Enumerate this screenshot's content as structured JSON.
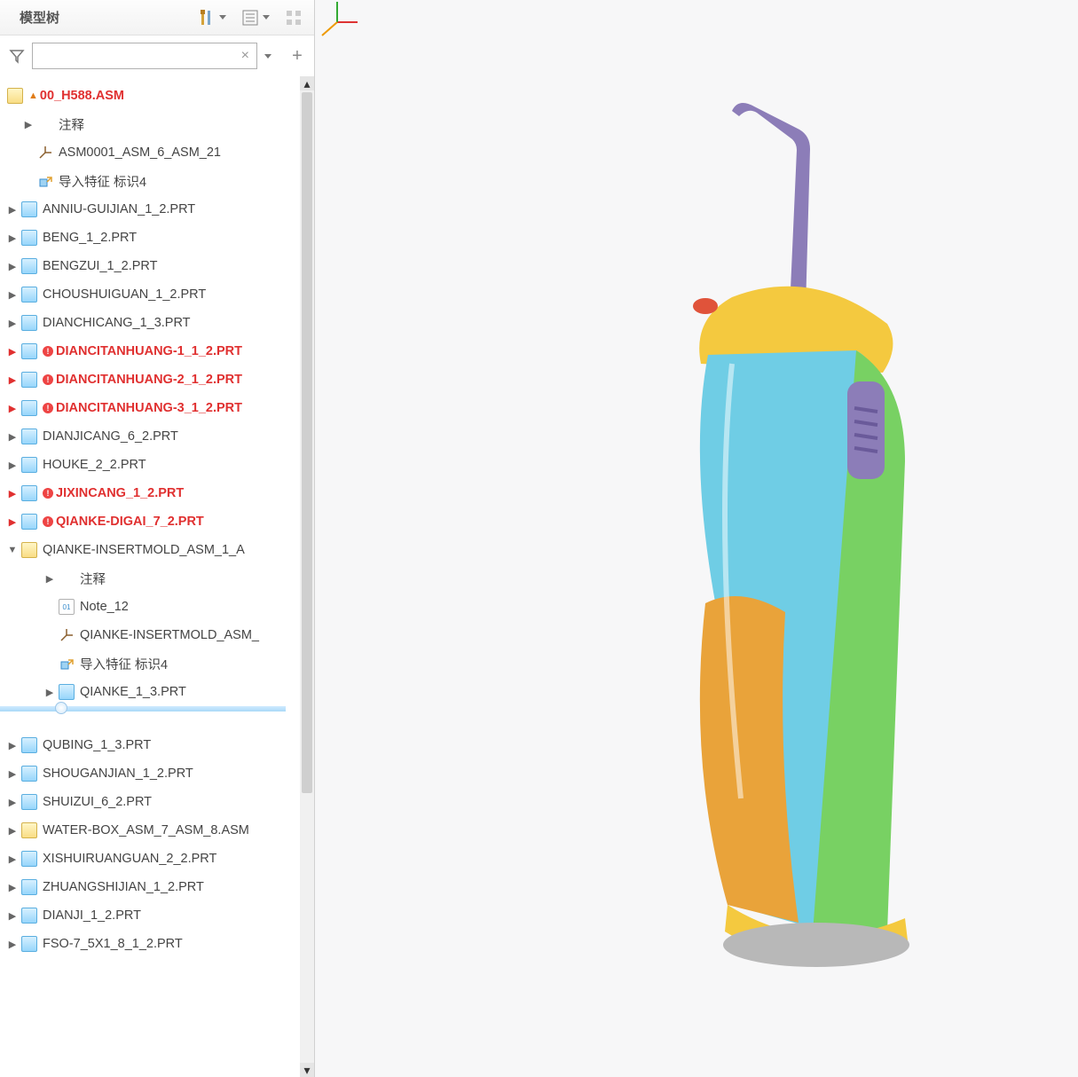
{
  "panel_title": "模型树",
  "root": {
    "name": "00_H588.ASM",
    "warning": true
  },
  "items": [
    {
      "exp": "closed",
      "indent": 1,
      "icon": "",
      "label": "注释"
    },
    {
      "exp": "none",
      "indent": 1,
      "icon": "csys",
      "label": "ASM0001_ASM_6_ASM_21"
    },
    {
      "exp": "none",
      "indent": 1,
      "icon": "import",
      "label": "导入特征 标识4"
    },
    {
      "exp": "closed",
      "indent": 0,
      "icon": "prt",
      "label": "ANNIU-GUIJIAN_1_2.PRT"
    },
    {
      "exp": "closed",
      "indent": 0,
      "icon": "prt",
      "label": "BENG_1_2.PRT"
    },
    {
      "exp": "closed",
      "indent": 0,
      "icon": "prt",
      "label": "BENGZUI_1_2.PRT"
    },
    {
      "exp": "closed",
      "indent": 0,
      "icon": "prt",
      "label": "CHOUSHUIGUAN_1_2.PRT"
    },
    {
      "exp": "closed",
      "indent": 0,
      "icon": "prt",
      "label": "DIANCHICANG_1_3.PRT"
    },
    {
      "exp": "closed",
      "indent": 0,
      "icon": "prt",
      "label": "DIANCITANHUANG-1_1_2.PRT",
      "error": true,
      "redExp": true
    },
    {
      "exp": "closed",
      "indent": 0,
      "icon": "prt",
      "label": "DIANCITANHUANG-2_1_2.PRT",
      "error": true,
      "redExp": true
    },
    {
      "exp": "closed",
      "indent": 0,
      "icon": "prt",
      "label": "DIANCITANHUANG-3_1_2.PRT",
      "error": true,
      "redExp": true
    },
    {
      "exp": "closed",
      "indent": 0,
      "icon": "prt",
      "label": "DIANJICANG_6_2.PRT"
    },
    {
      "exp": "closed",
      "indent": 0,
      "icon": "prt",
      "label": "HOUKE_2_2.PRT"
    },
    {
      "exp": "closed",
      "indent": 0,
      "icon": "prt",
      "label": "JIXINCANG_1_2.PRT",
      "error": true,
      "redExp": true
    },
    {
      "exp": "closed",
      "indent": 0,
      "icon": "prt",
      "label": "QIANKE-DIGAI_7_2.PRT",
      "error": true,
      "redExp": true
    },
    {
      "exp": "open",
      "indent": 0,
      "icon": "asm",
      "label": "QIANKE-INSERTMOLD_ASM_1_A"
    },
    {
      "exp": "closed",
      "indent": 2,
      "icon": "",
      "label": "注释"
    },
    {
      "exp": "none",
      "indent": 2,
      "icon": "note",
      "label": "Note_12"
    },
    {
      "exp": "none",
      "indent": 2,
      "icon": "csys",
      "label": "QIANKE-INSERTMOLD_ASM_"
    },
    {
      "exp": "none",
      "indent": 2,
      "icon": "import",
      "label": "导入特征 标识4"
    },
    {
      "exp": "closed",
      "indent": 2,
      "icon": "prt",
      "label": "QIANKE_1_3.PRT"
    }
  ],
  "items_after_split": [
    {
      "exp": "closed",
      "indent": 0,
      "icon": "prt",
      "label": "QUBING_1_3.PRT"
    },
    {
      "exp": "closed",
      "indent": 0,
      "icon": "prt",
      "label": "SHOUGANJIAN_1_2.PRT"
    },
    {
      "exp": "closed",
      "indent": 0,
      "icon": "prt",
      "label": "SHUIZUI_6_2.PRT"
    },
    {
      "exp": "closed",
      "indent": 0,
      "icon": "asm",
      "label": "WATER-BOX_ASM_7_ASM_8.ASM"
    },
    {
      "exp": "closed",
      "indent": 0,
      "icon": "prt",
      "label": "XISHUIRUANGUAN_2_2.PRT"
    },
    {
      "exp": "closed",
      "indent": 0,
      "icon": "prt",
      "label": "ZHUANGSHIJIAN_1_2.PRT"
    },
    {
      "exp": "closed",
      "indent": 0,
      "icon": "prt",
      "label": "DIANJI_1_2.PRT"
    },
    {
      "exp": "closed",
      "indent": 0,
      "icon": "prt",
      "label": "FSO-7_5X1_8_1_2.PRT"
    }
  ],
  "toolbar": {
    "tools_icon": "tools-icon",
    "list_icon": "list-settings-icon",
    "link_icon": "tree-settings-icon"
  },
  "search": {
    "placeholder": ""
  }
}
